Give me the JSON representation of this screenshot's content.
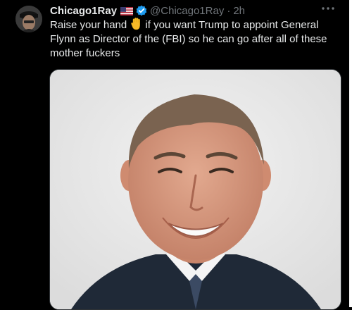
{
  "tweet": {
    "display_name": "Chicago1Ray",
    "handle": "@Chicago1Ray",
    "separator": "·",
    "time": "2h",
    "text_part1": "Raise your hand",
    "text_part2": "if you want Trump to appoint General Flynn as Director of the (FBI) so he can go after all of these mother fuckers",
    "badges": [
      "us-flag-icon",
      "verified-badge-icon"
    ],
    "more_icon": "more-options-icon",
    "inline_emoji": "raised-hand-emoji"
  },
  "colors": {
    "background": "#000000",
    "text": "#e7e9ea",
    "secondary_text": "#71767b",
    "verified_blue": "#1d9bf0",
    "media_background": "#ebebeb"
  }
}
